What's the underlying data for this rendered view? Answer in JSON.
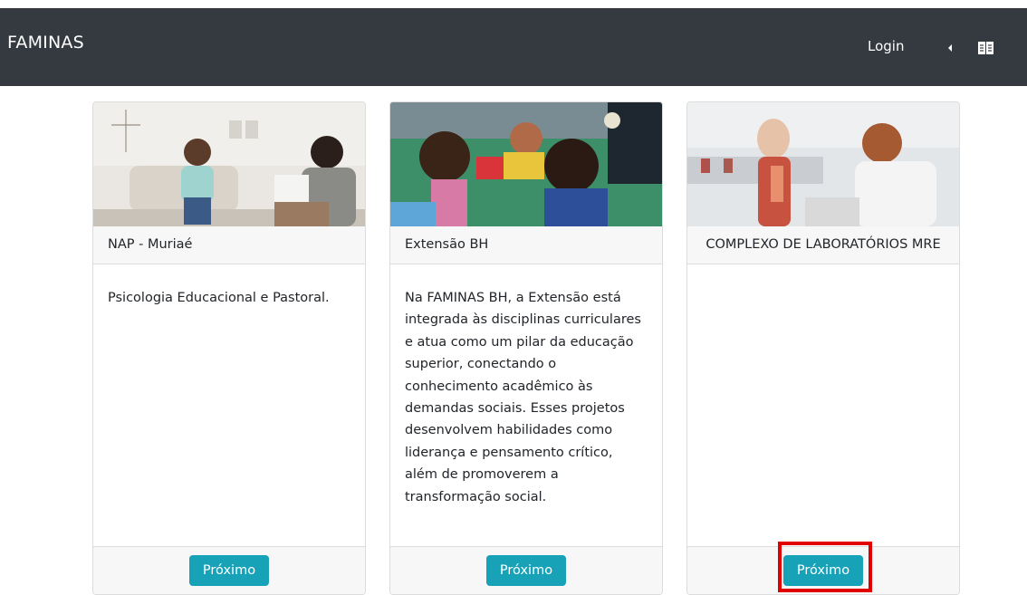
{
  "navbar": {
    "brand": "FAMINAS",
    "login_label": "Login",
    "caret_icon": "caret-left-icon",
    "language_icon": "book-icon"
  },
  "cards": [
    {
      "header": "NAP - Muriaé",
      "body": "Psicologia Educacional e Pastoral.",
      "button_label": "Próximo"
    },
    {
      "header": "Extensão BH",
      "body": "Na FAMINAS BH, a Extensão está integrada às disciplinas curriculares e atua como um pilar da educação superior, conectando o conhecimento acadêmico às demandas sociais. Esses projetos desenvolvem habilidades como liderança e pensamento crítico, além de promoverem a transformação social.",
      "button_label": "Próximo"
    },
    {
      "header": "COMPLEXO DE LABORATÓRIOS MRE",
      "body": "",
      "button_label": "Próximo"
    }
  ],
  "colors": {
    "navbar_bg": "#343a40",
    "button_bg": "#17a2b8",
    "highlight": "#e00000"
  }
}
